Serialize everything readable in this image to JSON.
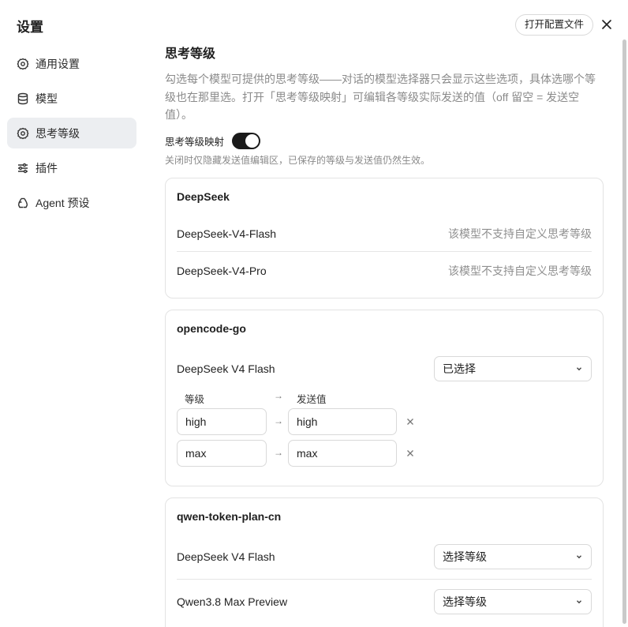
{
  "sidebar": {
    "title": "设置",
    "items": [
      {
        "label": "通用设置",
        "icon": "gear-icon",
        "active": false
      },
      {
        "label": "模型",
        "icon": "database-icon",
        "active": false
      },
      {
        "label": "思考等级",
        "icon": "gear-icon",
        "active": true
      },
      {
        "label": "插件",
        "icon": "sliders-icon",
        "active": false
      },
      {
        "label": "Agent 预设",
        "icon": "recycle-icon",
        "active": false
      }
    ]
  },
  "header": {
    "open_config_label": "打开配置文件",
    "close_icon": "close-icon"
  },
  "main": {
    "title": "思考等级",
    "description": "勾选每个模型可提供的思考等级——对话的模型选择器只会显示这些选项，具体选哪个等级也在那里选。打开「思考等级映射」可编辑各等级实际发送的值（off 留空 = 发送空值）。",
    "mapping_toggle": {
      "label": "思考等级映射",
      "on": true
    },
    "mapping_hint": "关闭时仅隐藏发送值编辑区，已保存的等级与发送值仍然生效。",
    "providers": [
      {
        "name": "DeepSeek",
        "models": [
          {
            "name": "DeepSeek-V4-Flash",
            "note": "该模型不支持自定义思考等级"
          },
          {
            "name": "DeepSeek-V4-Pro",
            "note": "该模型不支持自定义思考等级"
          }
        ]
      },
      {
        "name": "opencode-go",
        "models": [
          {
            "name": "DeepSeek V4 Flash",
            "select_value": "已选择",
            "mapping_headers": {
              "level": "等级",
              "send_value": "发送值"
            },
            "mappings": [
              {
                "level": "high",
                "value": "high"
              },
              {
                "level": "max",
                "value": "max"
              }
            ]
          }
        ]
      },
      {
        "name": "qwen-token-plan-cn",
        "models": [
          {
            "name": "DeepSeek V4 Flash",
            "select_value": "选择等级"
          },
          {
            "name": "Qwen3.8 Max Preview",
            "select_value": "选择等级"
          }
        ]
      }
    ]
  },
  "colors": {
    "toggle_on": "#1a1a1a",
    "active_nav_bg": "#eceef1",
    "muted_text": "#8a8a8a",
    "border": "#e3e3e3"
  }
}
